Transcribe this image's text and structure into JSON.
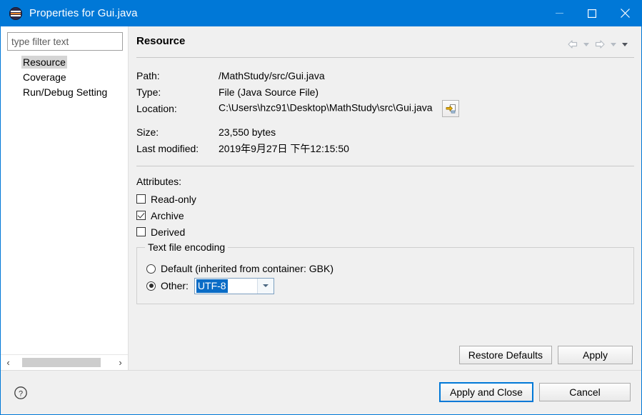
{
  "window": {
    "title": "Properties for Gui.java",
    "icon": "eclipse-icon",
    "minimize_label": "Minimize",
    "maximize_label": "Maximize",
    "close_label": "Close"
  },
  "sidebar": {
    "filter_placeholder": "type filter text",
    "filter_value": "",
    "items": [
      {
        "label": "Resource",
        "selected": true
      },
      {
        "label": "Coverage",
        "selected": false
      },
      {
        "label": "Run/Debug Setting",
        "selected": false
      }
    ],
    "scroll_left_glyph": "‹",
    "scroll_right_glyph": "›"
  },
  "page": {
    "title": "Resource",
    "nav": {
      "back_label": "Back",
      "back_menu_label": "Back history",
      "forward_label": "Forward",
      "forward_menu_label": "Forward history",
      "view_menu_label": "View menu"
    },
    "properties": [
      {
        "label": "Path:",
        "value": "/MathStudy/src/Gui.java"
      },
      {
        "label": "Type:",
        "value": "File  (Java Source File)"
      },
      {
        "label": "Location:",
        "value": "C:\\Users\\hzc91\\Desktop\\MathStudy\\src\\Gui.java"
      },
      {
        "label": "Size:",
        "value": "23,550  bytes"
      },
      {
        "label": "Last modified:",
        "value": "2019年9月27日 下午12:15:50"
      }
    ],
    "location_button_label": "Show in system explorer",
    "attributes": {
      "title": "Attributes:",
      "items": [
        {
          "label": "Read-only",
          "checked": false
        },
        {
          "label": "Archive",
          "checked": true
        },
        {
          "label": "Derived",
          "checked": false
        }
      ]
    },
    "encoding": {
      "legend": "Text file encoding",
      "default_label": "Default (inherited from container: GBK)",
      "default_selected": false,
      "other_label": "Other:",
      "other_selected": true,
      "combo_value": "UTF-8"
    },
    "buttons": {
      "restore_defaults": "Restore Defaults",
      "apply": "Apply"
    }
  },
  "footer": {
    "help_label": "?",
    "apply_and_close": "Apply and Close",
    "cancel": "Cancel"
  },
  "colors": {
    "titlebar": "#0078d7",
    "accent": "#0078d7",
    "selection": "#0a6cc6",
    "panel_bg": "#f0f0f0",
    "tree_bg": "#ffffff",
    "tree_selection": "#d5d5d5"
  }
}
